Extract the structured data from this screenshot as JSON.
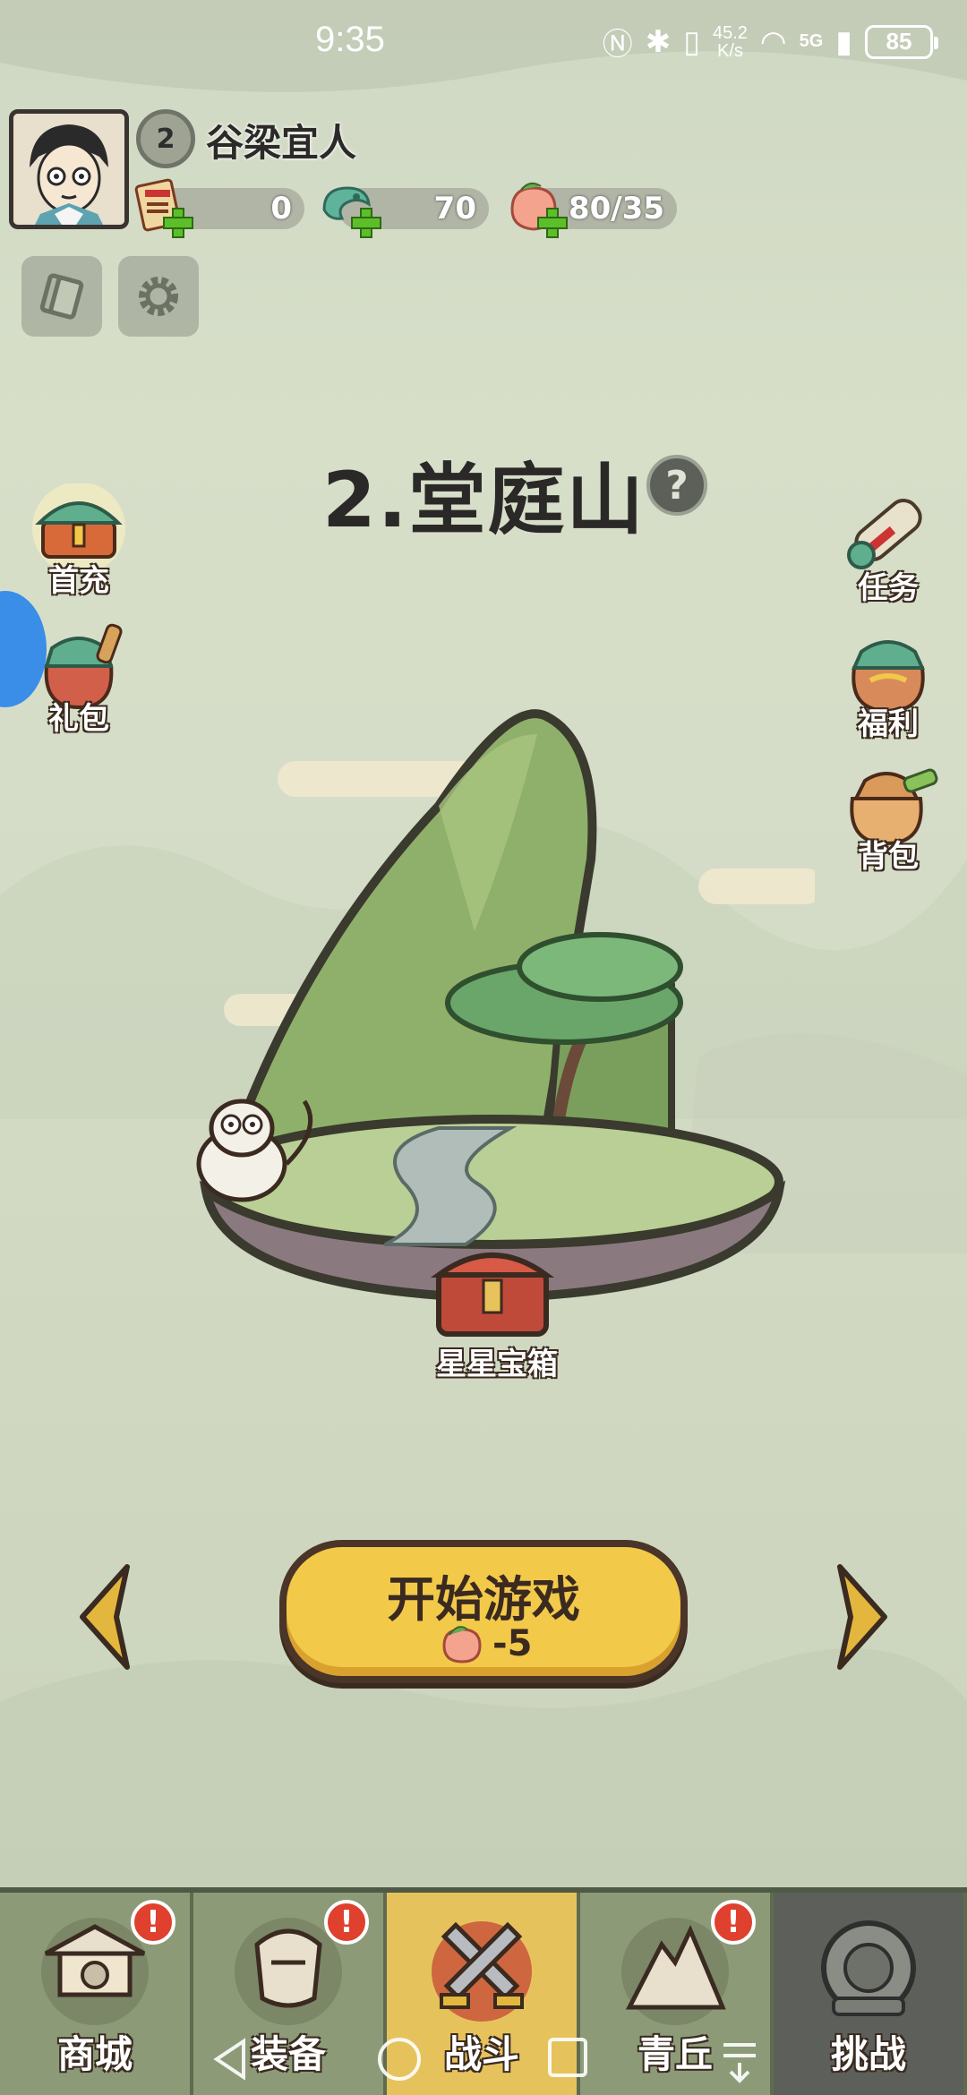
{
  "status_bar": {
    "time": "9:35",
    "net_speed_value": "45.2",
    "net_speed_unit": "K/s",
    "network": "5G",
    "battery": "85"
  },
  "player": {
    "level": "2",
    "name": "谷梁宜人",
    "resources": [
      {
        "icon": "scroll-ticket-icon",
        "value": "0"
      },
      {
        "icon": "jade-dragon-icon",
        "value": "70"
      },
      {
        "icon": "peach-icon",
        "value": "80/35"
      }
    ]
  },
  "top_buttons": [
    {
      "icon": "card-icon"
    },
    {
      "icon": "gear-icon"
    }
  ],
  "stage": {
    "title": "2.堂庭山",
    "help": "?",
    "chest_label": "星星宝箱"
  },
  "left_side": [
    {
      "label": "首充",
      "icon": "first-recharge-chest-icon"
    },
    {
      "label": "礼包",
      "icon": "gift-bag-icon"
    }
  ],
  "right_side": [
    {
      "label": "任务",
      "icon": "scroll-icon"
    },
    {
      "label": "福利",
      "icon": "welfare-bag-icon"
    },
    {
      "label": "背包",
      "icon": "backpack-icon"
    }
  ],
  "start_button": {
    "label": "开始游戏",
    "cost": "-5"
  },
  "bottom_nav": [
    {
      "label": "商城",
      "badge": "!",
      "state": "normal"
    },
    {
      "label": "装备",
      "badge": "!",
      "state": "normal"
    },
    {
      "label": "战斗",
      "badge": "",
      "state": "active"
    },
    {
      "label": "青丘",
      "badge": "!",
      "state": "normal"
    },
    {
      "label": "挑战",
      "badge": "",
      "state": "locked"
    }
  ],
  "colors": {
    "accent_yellow": "#f3c94a",
    "ink_dark": "#3a2a20",
    "badge_red": "#e0402e",
    "nav_green": "#8c9a78"
  }
}
